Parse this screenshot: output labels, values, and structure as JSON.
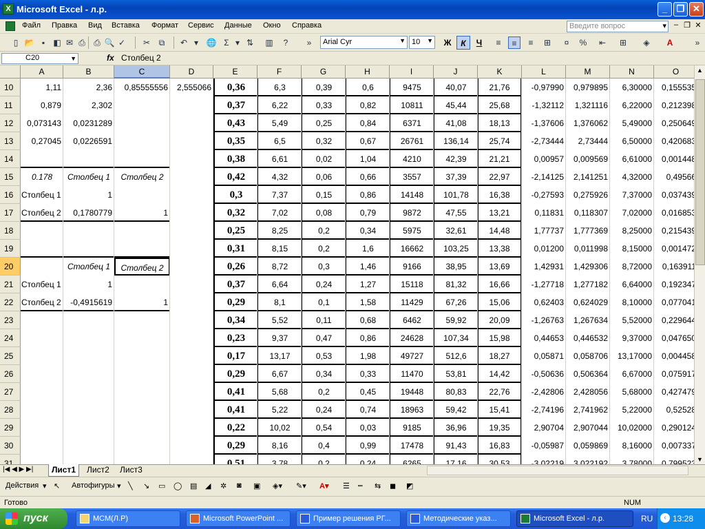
{
  "window": {
    "title": "Microsoft Excel - л.р.",
    "min": "_",
    "max": "❐",
    "close": "✕"
  },
  "menu": [
    "Файл",
    "Правка",
    "Вид",
    "Вставка",
    "Формат",
    "Сервис",
    "Данные",
    "Окно",
    "Справка"
  ],
  "help_placeholder": "Введите вопрос",
  "font": {
    "name": "Arial Cyr",
    "size": "10",
    "bold": "Ж",
    "italic": "К",
    "underline": "Ч"
  },
  "name_box": "C20",
  "formula": "Столбец 2",
  "fx": "fx",
  "columns": [
    "A",
    "B",
    "C",
    "D",
    "E",
    "F",
    "G",
    "H",
    "I",
    "J",
    "K",
    "L",
    "M",
    "N",
    "O"
  ],
  "rows": [
    {
      "n": "10",
      "A": "1,11",
      "B": "2,36",
      "C": "0,85555556",
      "D": "2,555066",
      "E": "0,36",
      "F": "6,3",
      "G": "0,39",
      "H": "0,6",
      "I": "9475",
      "J": "40,07",
      "K": "21,76",
      "L": "-0,97990",
      "M": "0,979895",
      "N": "6,30000",
      "O": "0,155535"
    },
    {
      "n": "11",
      "A": "0,879",
      "B": "2,302",
      "C": "",
      "D": "",
      "E": "0,37",
      "F": "6,22",
      "G": "0,33",
      "H": "0,82",
      "I": "10811",
      "J": "45,44",
      "K": "25,68",
      "L": "-1,32112",
      "M": "1,321116",
      "N": "6,22000",
      "O": "0,212398"
    },
    {
      "n": "12",
      "A": "0,073143",
      "B": "0,0231289",
      "C": "",
      "D": "",
      "E": "0,43",
      "F": "5,49",
      "G": "0,25",
      "H": "0,84",
      "I": "6371",
      "J": "41,08",
      "K": "18,13",
      "L": "-1,37606",
      "M": "1,376062",
      "N": "5,49000",
      "O": "0,250649"
    },
    {
      "n": "13",
      "A": "0,27045",
      "B": "0,0226591",
      "C": "",
      "D": "",
      "E": "0,35",
      "F": "6,5",
      "G": "0,32",
      "H": "0,67",
      "I": "26761",
      "J": "136,14",
      "K": "25,74",
      "L": "-2,73444",
      "M": "2,73444",
      "N": "6,50000",
      "O": "0,420683"
    },
    {
      "n": "14",
      "A": "",
      "B": "",
      "C": "",
      "D": "",
      "E": "0,38",
      "F": "6,61",
      "G": "0,02",
      "H": "1,04",
      "I": "4210",
      "J": "42,39",
      "K": "21,21",
      "L": "0,00957",
      "M": "0,009569",
      "N": "6,61000",
      "O": "0,001448"
    },
    {
      "n": "15",
      "A": "0.178",
      "B": "Столбец 1",
      "C": "Столбец 2",
      "D": "",
      "E": "0,42",
      "F": "4,32",
      "G": "0,06",
      "H": "0,66",
      "I": "3557",
      "J": "37,39",
      "K": "22,97",
      "L": "-2,14125",
      "M": "2,141251",
      "N": "4,32000",
      "O": "0,49566"
    },
    {
      "n": "16",
      "A": "Столбец 1",
      "B": "1",
      "C": "",
      "D": "",
      "E": "0,3",
      "F": "7,37",
      "G": "0,15",
      "H": "0,86",
      "I": "14148",
      "J": "101,78",
      "K": "16,38",
      "L": "-0,27593",
      "M": "0,275926",
      "N": "7,37000",
      "O": "0,037439"
    },
    {
      "n": "17",
      "A": "Столбец 2",
      "B": "0,1780779",
      "C": "1",
      "D": "",
      "E": "0,32",
      "F": "7,02",
      "G": "0,08",
      "H": "0,79",
      "I": "9872",
      "J": "47,55",
      "K": "13,21",
      "L": "0,11831",
      "M": "0,118307",
      "N": "7,02000",
      "O": "0,016853"
    },
    {
      "n": "18",
      "A": "",
      "B": "",
      "C": "",
      "D": "",
      "E": "0,25",
      "F": "8,25",
      "G": "0,2",
      "H": "0,34",
      "I": "5975",
      "J": "32,61",
      "K": "14,48",
      "L": "1,77737",
      "M": "1,777369",
      "N": "8,25000",
      "O": "0,215439"
    },
    {
      "n": "19",
      "A": "",
      "B": "",
      "C": "",
      "D": "",
      "E": "0,31",
      "F": "8,15",
      "G": "0,2",
      "H": "1,6",
      "I": "16662",
      "J": "103,25",
      "K": "13,38",
      "L": "0,01200",
      "M": "0,011998",
      "N": "8,15000",
      "O": "0,001472"
    },
    {
      "n": "20",
      "A": "",
      "B": "Столбец 1",
      "C": "Столбец 2",
      "D": "",
      "E": "0,26",
      "F": "8,72",
      "G": "0,3",
      "H": "1,46",
      "I": "9166",
      "J": "38,95",
      "K": "13,69",
      "L": "1,42931",
      "M": "1,429306",
      "N": "8,72000",
      "O": "0,163911"
    },
    {
      "n": "21",
      "A": "Столбец 1",
      "B": "1",
      "C": "",
      "D": "",
      "E": "0,37",
      "F": "6,64",
      "G": "0,24",
      "H": "1,27",
      "I": "15118",
      "J": "81,32",
      "K": "16,66",
      "L": "-1,27718",
      "M": "1,277182",
      "N": "6,64000",
      "O": "0,192347"
    },
    {
      "n": "22",
      "A": "Столбец 2",
      "B": "-0,4915619",
      "C": "1",
      "D": "",
      "E": "0,29",
      "F": "8,1",
      "G": "0,1",
      "H": "1,58",
      "I": "11429",
      "J": "67,26",
      "K": "15,06",
      "L": "0,62403",
      "M": "0,624029",
      "N": "8,10000",
      "O": "0,077041"
    },
    {
      "n": "23",
      "A": "",
      "B": "",
      "C": "",
      "D": "",
      "E": "0,34",
      "F": "5,52",
      "G": "0,11",
      "H": "0,68",
      "I": "6462",
      "J": "59,92",
      "K": "20,09",
      "L": "-1,26763",
      "M": "1,267634",
      "N": "5,52000",
      "O": "0,229644"
    },
    {
      "n": "24",
      "A": "",
      "B": "",
      "C": "",
      "D": "",
      "E": "0,23",
      "F": "9,37",
      "G": "0,47",
      "H": "0,86",
      "I": "24628",
      "J": "107,34",
      "K": "15,98",
      "L": "0,44653",
      "M": "0,446532",
      "N": "9,37000",
      "O": "0,047650"
    },
    {
      "n": "25",
      "A": "",
      "B": "",
      "C": "",
      "D": "",
      "E": "0,17",
      "F": "13,17",
      "G": "0,53",
      "H": "1,98",
      "I": "49727",
      "J": "512,6",
      "K": "18,27",
      "L": "0,05871",
      "M": "0,058706",
      "N": "13,17000",
      "O": "0,004458"
    },
    {
      "n": "26",
      "A": "",
      "B": "",
      "C": "",
      "D": "",
      "E": "0,29",
      "F": "6,67",
      "G": "0,34",
      "H": "0,33",
      "I": "11470",
      "J": "53,81",
      "K": "14,42",
      "L": "-0,50636",
      "M": "0,506364",
      "N": "6,67000",
      "O": "0,075917"
    },
    {
      "n": "27",
      "A": "",
      "B": "",
      "C": "",
      "D": "",
      "E": "0,41",
      "F": "5,68",
      "G": "0,2",
      "H": "0,45",
      "I": "19448",
      "J": "80,83",
      "K": "22,76",
      "L": "-2,42806",
      "M": "2,428056",
      "N": "5,68000",
      "O": "0,427479"
    },
    {
      "n": "28",
      "A": "",
      "B": "",
      "C": "",
      "D": "",
      "E": "0,41",
      "F": "5,22",
      "G": "0,24",
      "H": "0,74",
      "I": "18963",
      "J": "59,42",
      "K": "15,41",
      "L": "-2,74196",
      "M": "2,741962",
      "N": "5,22000",
      "O": "0,52528"
    },
    {
      "n": "29",
      "A": "",
      "B": "",
      "C": "",
      "D": "",
      "E": "0,22",
      "F": "10,02",
      "G": "0,54",
      "H": "0,03",
      "I": "9185",
      "J": "36,96",
      "K": "19,35",
      "L": "2,90704",
      "M": "2,907044",
      "N": "10,02000",
      "O": "0,290124"
    },
    {
      "n": "30",
      "A": "",
      "B": "",
      "C": "",
      "D": "",
      "E": "0,29",
      "F": "8,16",
      "G": "0,4",
      "H": "0,99",
      "I": "17478",
      "J": "91,43",
      "K": "16,83",
      "L": "-0,05987",
      "M": "0,059869",
      "N": "8,16000",
      "O": "0,007337"
    },
    {
      "n": "31",
      "A": "",
      "B": "",
      "C": "",
      "D": "",
      "E": "0,51",
      "F": "3,78",
      "G": "0,2",
      "H": "0,24",
      "I": "6265",
      "J": "17,16",
      "K": "30,53",
      "L": "-3,02219",
      "M": "3,022192",
      "N": "3,78000",
      "O": "0,799523"
    }
  ],
  "sheets": [
    "Лист1",
    "Лист2",
    "Лист3"
  ],
  "draw": {
    "actions": "Действия",
    "autoshapes": "Автофигуры"
  },
  "status": {
    "ready": "Готово",
    "num": "NUM"
  },
  "taskbar": {
    "start": "пуск",
    "tasks": [
      "МСМ(Л.Р)",
      "Microsoft PowerPoint ...",
      "Пример решения РГ...",
      "Методические указ...",
      "Microsoft Excel - л.р."
    ],
    "lang": "RU",
    "time": "13:28"
  },
  "colors": {
    "title": "#0a55d2",
    "selection": "#ffcc66",
    "taskbar": "#245edb",
    "start": "#2f8a2f"
  }
}
